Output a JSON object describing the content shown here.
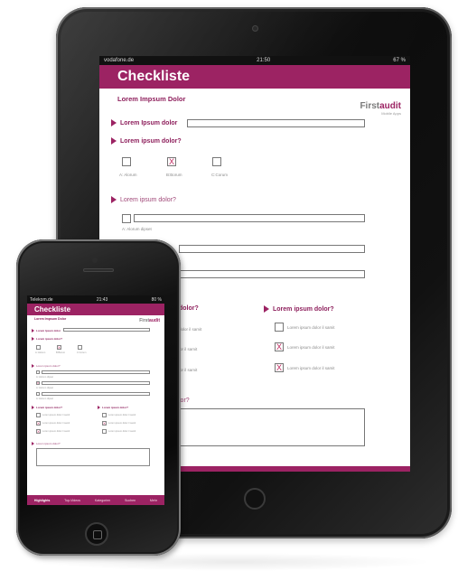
{
  "ipad": {
    "status": {
      "carrier": "vodafone.de",
      "time": "21:50",
      "battery": "67 %"
    },
    "title": "Checkliste",
    "subtitle": "Lorem Impsum Dolor",
    "logo": {
      "first": "First",
      "audit": "audit",
      "tagline": "Mobile Apps"
    },
    "questions": [
      "Lorem Ipsum dolor",
      "Lorem ipsum dolor?",
      "Lorem ipsum dolor?",
      "dolor?",
      "Lorem ipsum dolor?",
      "lor?"
    ],
    "options": [
      "A: Alorum",
      "B:Borum",
      "C:Corum"
    ],
    "check_marks": [
      "",
      "X",
      ""
    ],
    "field_label": "A: Alorum dipset",
    "left_partial_items": [
      "dolor il samit",
      "lor il samit",
      "lor il samit"
    ],
    "right_items": [
      "Lorem ipsum dolor il samit",
      "Lorem ipsum dolor il samit",
      "Lorem ipsum dolor il samit"
    ],
    "right_marks": [
      "",
      "X",
      "X"
    ]
  },
  "iphone": {
    "status": {
      "carrier": "Telekom.de",
      "time": "21:43",
      "battery": "80 %"
    },
    "title": "Checkliste",
    "subtitle": "Lorem Impsum Dolor",
    "logo": {
      "first": "First",
      "audit": "audit"
    },
    "questions": [
      "Lorem Ipsum dolor",
      "Lorem ipsum dolor?",
      "Lorem ipsum dolor?",
      "Lorem ipsum dolor?",
      "Lorem ipsum dolor?",
      "Lorem ipsum dolor?"
    ],
    "options": [
      "A: Alorum",
      "B:Borum",
      "C:Corum"
    ],
    "check_marks": [
      "",
      "X",
      ""
    ],
    "field_labels": [
      "A: Alorum dipset",
      "A: Alorum dipset",
      "A: Alorum dipset"
    ],
    "left_items": [
      "Lorem ipsum dolor il samit",
      "Lorem ipsum dolor il samit",
      "Lorem ipsum dolor il samit"
    ],
    "left_marks": [
      "",
      "X",
      "X"
    ],
    "right_items": [
      "Lorem ipsum dolor il samit",
      "Lorem ipsum dolor il samit",
      "Lorem ipsum dolor il samit"
    ],
    "right_marks": [
      "",
      "X",
      ""
    ],
    "tabs": [
      "Highlights",
      "Top-Videos",
      "Kategorien",
      "Suchen",
      "Mehr"
    ]
  },
  "colors": {
    "brand": "#9c2363",
    "brand_text": "#8e1f5c",
    "check": "#c0285f"
  }
}
